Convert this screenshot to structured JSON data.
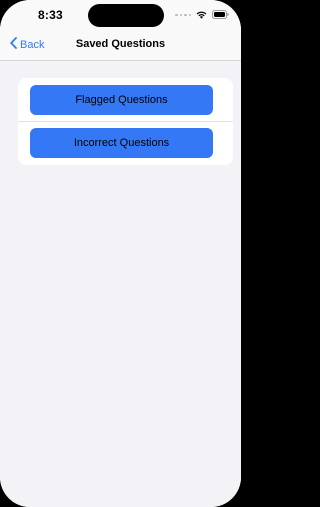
{
  "status_bar": {
    "time": "8:33",
    "icons": [
      "cellular-dots-icon",
      "wifi-icon",
      "battery-icon"
    ]
  },
  "nav": {
    "back_label": "Back",
    "back_icon": "chevron-left-icon",
    "title": "Saved Questions"
  },
  "buttons": {
    "flagged_label": "Flagged Questions",
    "incorrect_label": "Incorrect Questions"
  },
  "colors": {
    "accent": "#3478F6",
    "back_link": "#2F7CF6",
    "background": "#F2F2F7",
    "card": "#FFFFFF"
  }
}
